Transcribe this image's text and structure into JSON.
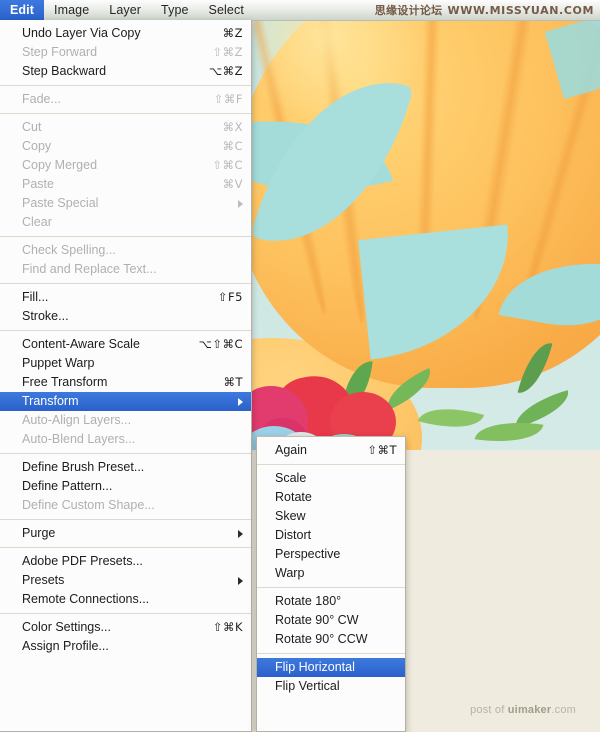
{
  "app": {
    "menubar": {
      "items": [
        {
          "label": "Edit",
          "active": true
        },
        {
          "label": "Image",
          "active": false
        },
        {
          "label": "Layer",
          "active": false
        },
        {
          "label": "Type",
          "active": false
        },
        {
          "label": "Select",
          "active": false
        }
      ]
    },
    "watermarks": {
      "top_cn": "思缘设计论坛",
      "top_url": "WWW.MISSYUAN.COM",
      "bottom_prefix": "post of ",
      "bottom_brand": "uimaker",
      "bottom_suffix": ".com"
    },
    "artwork": {
      "description": "illustration-pumpkin-with-teal-leaves-and-flowers",
      "colors": {
        "sky": "#c9e5e2",
        "pumpkin": "#fcc264",
        "leaf_teal": "#a4dcda",
        "flower_red": "#e8394a",
        "flower_pink": "#e23b6e",
        "leaf_green": "#74b85a"
      }
    },
    "background_color": "#efebde",
    "accent_color": "#2a62cd"
  },
  "edit_menu": {
    "title": "Edit",
    "groups": [
      {
        "items": [
          {
            "label": "Undo Layer Via Copy",
            "shortcut": "⌘Z",
            "state": "enabled"
          },
          {
            "label": "Step Forward",
            "shortcut": "⇧⌘Z",
            "state": "disabled"
          },
          {
            "label": "Step Backward",
            "shortcut": "⌥⌘Z",
            "state": "enabled"
          }
        ]
      },
      {
        "items": [
          {
            "label": "Fade...",
            "shortcut": "⇧⌘F",
            "state": "disabled"
          }
        ]
      },
      {
        "items": [
          {
            "label": "Cut",
            "shortcut": "⌘X",
            "state": "disabled"
          },
          {
            "label": "Copy",
            "shortcut": "⌘C",
            "state": "disabled"
          },
          {
            "label": "Copy Merged",
            "shortcut": "⇧⌘C",
            "state": "disabled"
          },
          {
            "label": "Paste",
            "shortcut": "⌘V",
            "state": "disabled"
          },
          {
            "label": "Paste Special",
            "shortcut": "",
            "state": "disabled",
            "submenu": true
          },
          {
            "label": "Clear",
            "shortcut": "",
            "state": "disabled"
          }
        ]
      },
      {
        "items": [
          {
            "label": "Check Spelling...",
            "shortcut": "",
            "state": "disabled"
          },
          {
            "label": "Find and Replace Text...",
            "shortcut": "",
            "state": "disabled"
          }
        ]
      },
      {
        "items": [
          {
            "label": "Fill...",
            "shortcut": "⇧F5",
            "state": "enabled"
          },
          {
            "label": "Stroke...",
            "shortcut": "",
            "state": "enabled"
          }
        ]
      },
      {
        "items": [
          {
            "label": "Content-Aware Scale",
            "shortcut": "⌥⇧⌘C",
            "state": "enabled"
          },
          {
            "label": "Puppet Warp",
            "shortcut": "",
            "state": "enabled"
          },
          {
            "label": "Free Transform",
            "shortcut": "⌘T",
            "state": "enabled"
          },
          {
            "label": "Transform",
            "shortcut": "",
            "state": "selected",
            "submenu": true
          },
          {
            "label": "Auto-Align Layers...",
            "shortcut": "",
            "state": "disabled"
          },
          {
            "label": "Auto-Blend Layers...",
            "shortcut": "",
            "state": "disabled"
          }
        ]
      },
      {
        "items": [
          {
            "label": "Define Brush Preset...",
            "shortcut": "",
            "state": "enabled"
          },
          {
            "label": "Define Pattern...",
            "shortcut": "",
            "state": "enabled"
          },
          {
            "label": "Define Custom Shape...",
            "shortcut": "",
            "state": "disabled"
          }
        ]
      },
      {
        "items": [
          {
            "label": "Purge",
            "shortcut": "",
            "state": "enabled",
            "submenu": true
          }
        ]
      },
      {
        "items": [
          {
            "label": "Adobe PDF Presets...",
            "shortcut": "",
            "state": "enabled"
          },
          {
            "label": "Presets",
            "shortcut": "",
            "state": "enabled",
            "submenu": true
          },
          {
            "label": "Remote Connections...",
            "shortcut": "",
            "state": "enabled"
          }
        ]
      },
      {
        "items": [
          {
            "label": "Color Settings...",
            "shortcut": "⇧⌘K",
            "state": "enabled"
          },
          {
            "label": "Assign Profile...",
            "shortcut": "",
            "state": "enabled"
          }
        ]
      }
    ]
  },
  "transform_menu": {
    "title": "Transform",
    "groups": [
      {
        "items": [
          {
            "label": "Again",
            "shortcut": "⇧⌘T",
            "state": "enabled"
          }
        ]
      },
      {
        "items": [
          {
            "label": "Scale",
            "shortcut": "",
            "state": "enabled"
          },
          {
            "label": "Rotate",
            "shortcut": "",
            "state": "enabled"
          },
          {
            "label": "Skew",
            "shortcut": "",
            "state": "enabled"
          },
          {
            "label": "Distort",
            "shortcut": "",
            "state": "enabled"
          },
          {
            "label": "Perspective",
            "shortcut": "",
            "state": "enabled"
          },
          {
            "label": "Warp",
            "shortcut": "",
            "state": "enabled"
          }
        ]
      },
      {
        "items": [
          {
            "label": "Rotate 180°",
            "shortcut": "",
            "state": "enabled"
          },
          {
            "label": "Rotate 90° CW",
            "shortcut": "",
            "state": "enabled"
          },
          {
            "label": "Rotate 90° CCW",
            "shortcut": "",
            "state": "enabled"
          }
        ]
      },
      {
        "items": [
          {
            "label": "Flip Horizontal",
            "shortcut": "",
            "state": "selected"
          },
          {
            "label": "Flip Vertical",
            "shortcut": "",
            "state": "enabled"
          }
        ]
      }
    ]
  }
}
